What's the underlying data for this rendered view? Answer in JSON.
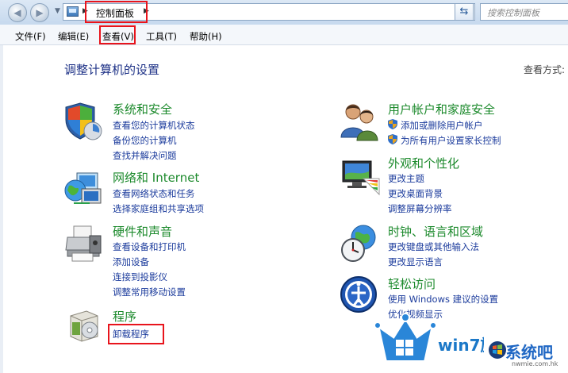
{
  "address_bar": {
    "breadcrumb": "控制面板",
    "search_placeholder": "搜索控制面板"
  },
  "menu": [
    "文件(F)",
    "编辑(E)",
    "查看(V)",
    "工具(T)",
    "帮助(H)"
  ],
  "page": {
    "heading": "调整计算机的设置",
    "view_by": "查看方式:"
  },
  "categories": [
    {
      "title": "系统和安全",
      "icon": "shield-flag-icon",
      "links": [
        "查看您的计算机状态",
        "备份您的计算机",
        "查找并解决问题"
      ]
    },
    {
      "title": "网络和 Internet",
      "icon": "network-globe-icon",
      "links": [
        "查看网络状态和任务",
        "选择家庭组和共享选项"
      ]
    },
    {
      "title": "硬件和声音",
      "icon": "printer-icon",
      "links": [
        "查看设备和打印机",
        "添加设备",
        "连接到投影仪",
        "调整常用移动设置"
      ]
    },
    {
      "title": "程序",
      "icon": "programs-box-icon",
      "links": [
        "卸载程序"
      ]
    },
    {
      "title": "用户帐户和家庭安全",
      "icon": "users-icon",
      "links": [
        "添加或删除用户帐户",
        "为所有用户设置家长控制"
      ]
    },
    {
      "title": "外观和个性化",
      "icon": "monitor-palette-icon",
      "links": [
        "更改主题",
        "更改桌面背景",
        "调整屏幕分辨率"
      ]
    },
    {
      "title": "时钟、语言和区域",
      "icon": "clock-globe-icon",
      "links": [
        "更改键盘或其他输入法",
        "更改显示语言"
      ]
    },
    {
      "title": "轻松访问",
      "icon": "ease-of-access-icon",
      "links": [
        "使用 Windows 建议的设置",
        "优化视频显示"
      ]
    }
  ],
  "watermark": {
    "site_text": "win7旗舰版",
    "brand_text": "系统吧",
    "url_text": "nwmie.com.hk"
  },
  "colors": {
    "category_title": "#1c8a2c",
    "link": "#1b3b9c",
    "heading": "#1e3287",
    "highlight_box": "#e8141c"
  }
}
